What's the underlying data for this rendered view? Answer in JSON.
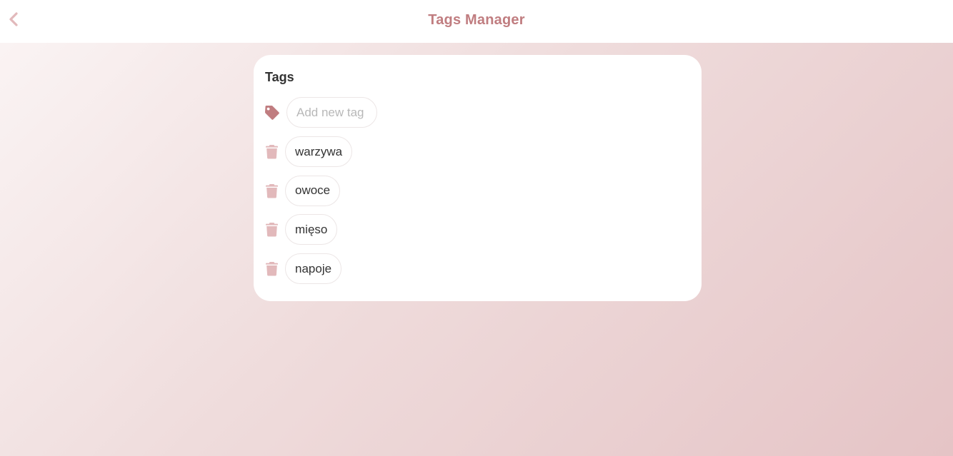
{
  "header": {
    "title": "Tags Manager",
    "back_icon": "chevron-left-icon"
  },
  "card": {
    "title": "Tags",
    "add_input": {
      "placeholder": "Add new tag",
      "value": "",
      "icon": "tag-icon"
    },
    "tags": [
      {
        "label": "warzywa"
      },
      {
        "label": "owoce"
      },
      {
        "label": "mięso"
      },
      {
        "label": "napoje"
      }
    ],
    "delete_icon": "trash-icon"
  },
  "colors": {
    "accent": "#c07d80",
    "icon_muted": "#e2b9bb",
    "text": "#333333"
  }
}
